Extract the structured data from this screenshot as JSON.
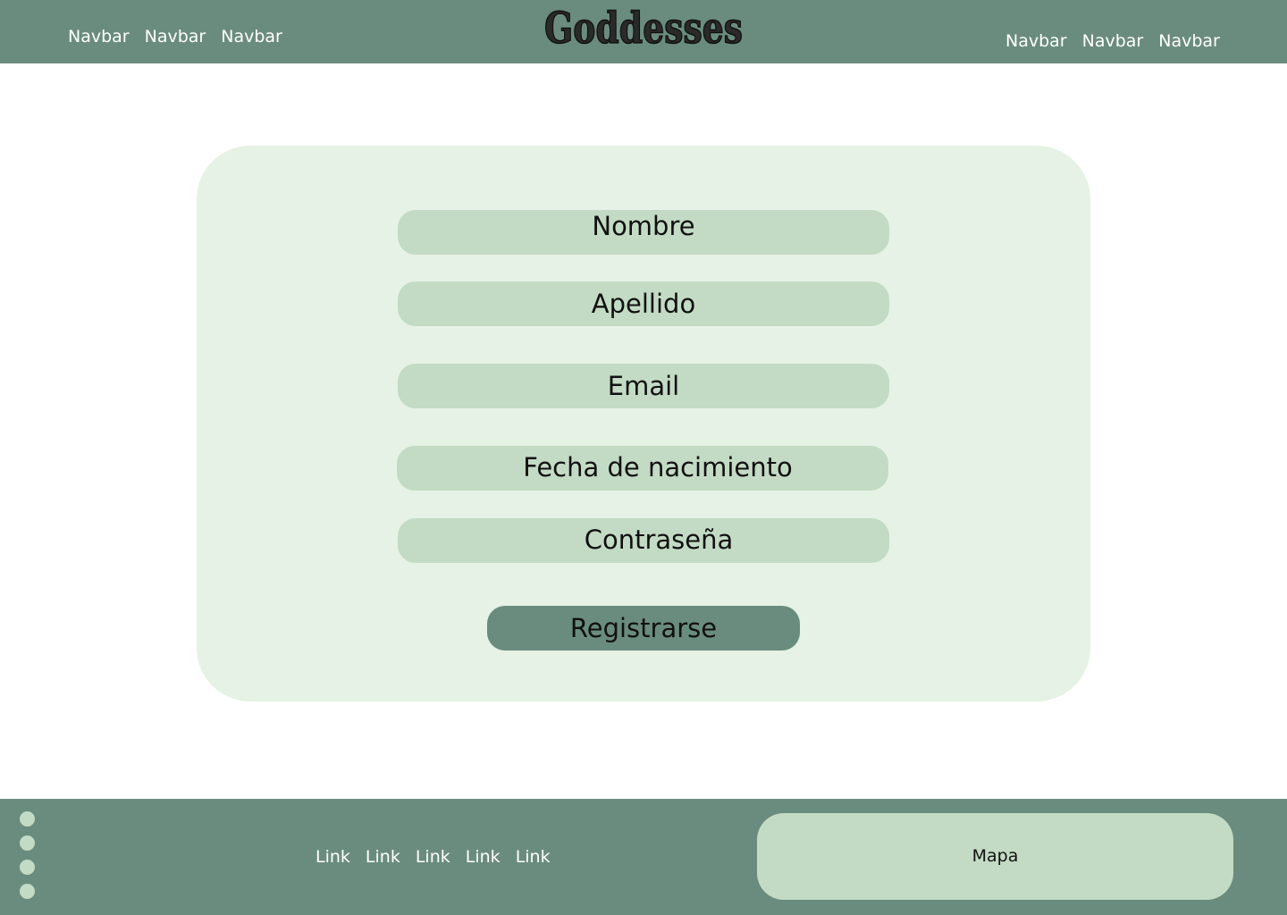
{
  "colors": {
    "header_bg": "#6a8c7e",
    "card_bg": "#e5f2e5",
    "field_bg": "#c3dbc4",
    "button_bg": "#6a8c7e",
    "footer_bg": "#6a8c7e",
    "nav_text": "#ffffff",
    "body_text": "#111111"
  },
  "header": {
    "logo_text": "Goddesses",
    "nav_left": [
      "Navbar",
      "Navbar",
      "Navbar"
    ],
    "nav_right": [
      "Navbar",
      "Navbar",
      "Navbar"
    ]
  },
  "form": {
    "fields": [
      {
        "label": "Nombre"
      },
      {
        "label": "Apellido"
      },
      {
        "label": "Email"
      },
      {
        "label": "Fecha de nacimiento"
      },
      {
        "label": "Contraseña"
      }
    ],
    "submit_label": "Registrarse"
  },
  "footer": {
    "dot_icons": [
      "dot-icon",
      "dot-icon",
      "dot-icon",
      "dot-icon"
    ],
    "links": [
      "Link",
      "Link",
      "Link",
      "Link",
      "Link"
    ],
    "map_label": "Mapa"
  }
}
